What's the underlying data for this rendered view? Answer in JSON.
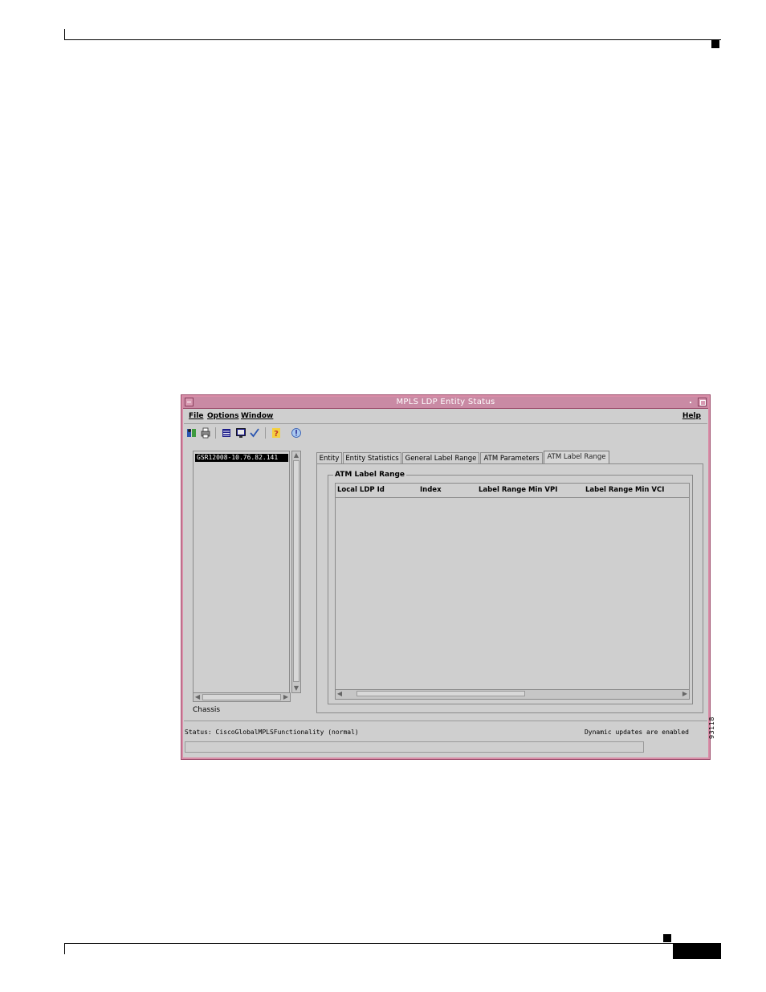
{
  "window": {
    "title": "MPLS LDP Entity Status"
  },
  "menubar": {
    "file": "File",
    "options": "Options",
    "window": "Window",
    "help": "Help"
  },
  "toolbar": {
    "icons": [
      "open-icon",
      "print-icon",
      "list-icon",
      "monitor-icon",
      "check-icon",
      "help-icon",
      "info-icon"
    ]
  },
  "tree": {
    "selected_node": "GSR12008-10.76.82.141",
    "panel_label": "Chassis"
  },
  "tabs": {
    "items": [
      "Entity",
      "Entity Statistics",
      "General Label Range",
      "ATM Parameters",
      "ATM Label Range"
    ],
    "active_index": 4
  },
  "group": {
    "title": "ATM Label Range",
    "columns": [
      "Local LDP Id",
      "Index",
      "Label Range Min VPI",
      "Label Range Min VCI"
    ],
    "rows": []
  },
  "status": {
    "text": "Status: CiscoGlobalMPLSFunctionality (normal)",
    "updates": "Dynamic updates are enabled",
    "progress": 0
  },
  "figure": {
    "number": "93118"
  },
  "colors": {
    "titlebar": "#c98aa4",
    "window_border": "#9b4b6a",
    "window_bg": "#cfcfcf",
    "selection": "#000000"
  }
}
